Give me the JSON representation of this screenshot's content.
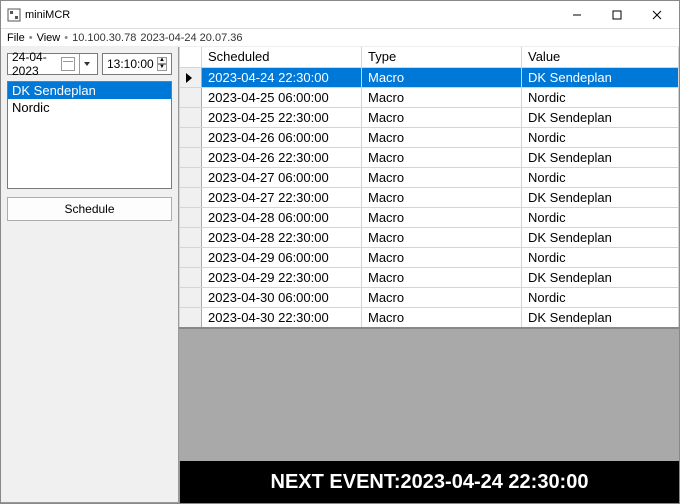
{
  "window": {
    "title": "miniMCR"
  },
  "menu": {
    "file": "File",
    "view": "View",
    "info_ip": "10.100.30.78",
    "info_time": "2023-04-24 20.07.36"
  },
  "sidebar": {
    "date_value": "24-04-2023",
    "time_value": "13:10:00",
    "list": [
      {
        "label": "DK Sendeplan",
        "selected": true
      },
      {
        "label": "Nordic",
        "selected": false
      }
    ],
    "schedule_btn": "Schedule"
  },
  "grid": {
    "headers": {
      "scheduled": "Scheduled",
      "type": "Type",
      "value": "Value"
    },
    "rows": [
      {
        "scheduled": "2023-04-24 22:30:00",
        "type": "Macro",
        "value": "DK Sendeplan",
        "selected": true
      },
      {
        "scheduled": "2023-04-25 06:00:00",
        "type": "Macro",
        "value": "Nordic"
      },
      {
        "scheduled": "2023-04-25 22:30:00",
        "type": "Macro",
        "value": "DK Sendeplan"
      },
      {
        "scheduled": "2023-04-26 06:00:00",
        "type": "Macro",
        "value": "Nordic"
      },
      {
        "scheduled": "2023-04-26 22:30:00",
        "type": "Macro",
        "value": "DK Sendeplan"
      },
      {
        "scheduled": "2023-04-27 06:00:00",
        "type": "Macro",
        "value": "Nordic"
      },
      {
        "scheduled": "2023-04-27 22:30:00",
        "type": "Macro",
        "value": "DK Sendeplan"
      },
      {
        "scheduled": "2023-04-28 06:00:00",
        "type": "Macro",
        "value": "Nordic"
      },
      {
        "scheduled": "2023-04-28 22:30:00",
        "type": "Macro",
        "value": "DK Sendeplan"
      },
      {
        "scheduled": "2023-04-29 06:00:00",
        "type": "Macro",
        "value": "Nordic"
      },
      {
        "scheduled": "2023-04-29 22:30:00",
        "type": "Macro",
        "value": "DK Sendeplan"
      },
      {
        "scheduled": "2023-04-30 06:00:00",
        "type": "Macro",
        "value": "Nordic"
      },
      {
        "scheduled": "2023-04-30 22:30:00",
        "type": "Macro",
        "value": "DK Sendeplan"
      }
    ]
  },
  "footer": {
    "prefix": "NEXT EVENT: ",
    "time": "2023-04-24 22:30:00"
  }
}
